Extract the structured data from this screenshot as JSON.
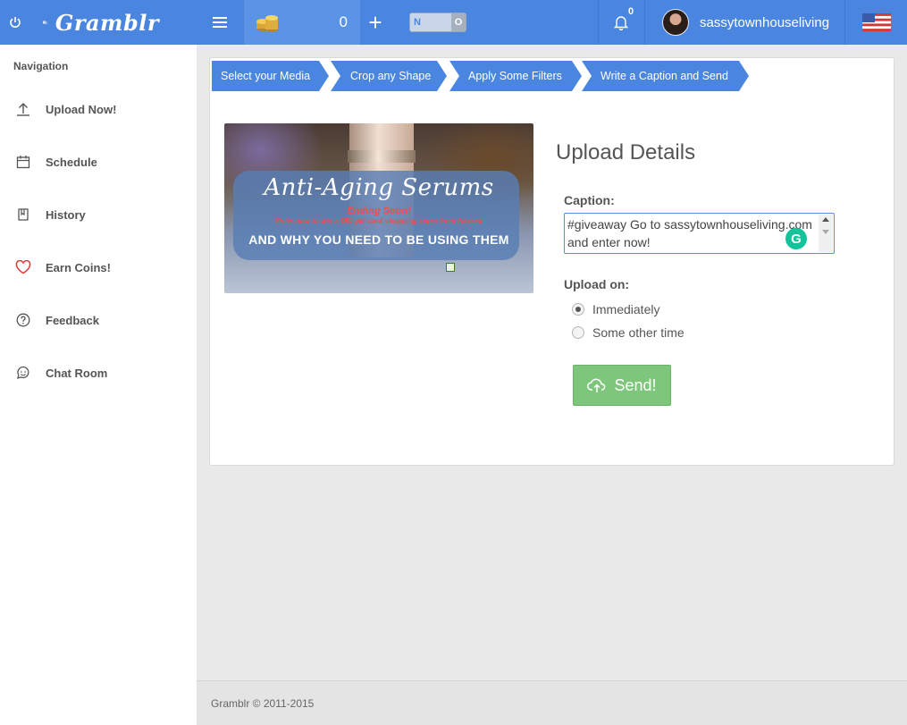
{
  "app": {
    "brand": "Gramblr"
  },
  "topbar": {
    "coin_count": "0",
    "toggle_left": "N",
    "toggle_right": "O",
    "notification_count": "0",
    "username": "sassytownhouseliving"
  },
  "sidebar": {
    "title": "Navigation",
    "items": [
      {
        "label": "Upload Now!",
        "icon": "upload-icon"
      },
      {
        "label": "Schedule",
        "icon": "calendar-icon"
      },
      {
        "label": "History",
        "icon": "book-icon"
      },
      {
        "label": "Earn Coins!",
        "icon": "heart-icon"
      },
      {
        "label": "Feedback",
        "icon": "question-icon"
      },
      {
        "label": "Chat Room",
        "icon": "chat-icon"
      }
    ]
  },
  "steps": [
    "Select your Media",
    "Crop any Shape",
    "Apply Some Filters",
    "Write a Caption and Send"
  ],
  "preview": {
    "title": "Anti-Aging Serums",
    "subtitle": "Ending Soon!",
    "subtitle2": "Enter now to win a $50 gift card shopping spree from Nexcell",
    "tagline": "AND WHY YOU NEED TO BE USING THEM"
  },
  "details": {
    "title": "Upload Details",
    "caption_label": "Caption:",
    "caption_value": "#giveaway Go to sassytownhouseliving.com and enter now!",
    "upload_on_label": "Upload on:",
    "options": [
      "Immediately",
      "Some other time"
    ],
    "selected_option": "Immediately",
    "send_label": "Send!"
  },
  "footer": {
    "copyright": "Gramblr © 2011-2015"
  },
  "colors": {
    "primary": "#4a86e0",
    "send": "#7dc67c",
    "grammarly": "#15c39a",
    "heart": "#e03a3a"
  }
}
